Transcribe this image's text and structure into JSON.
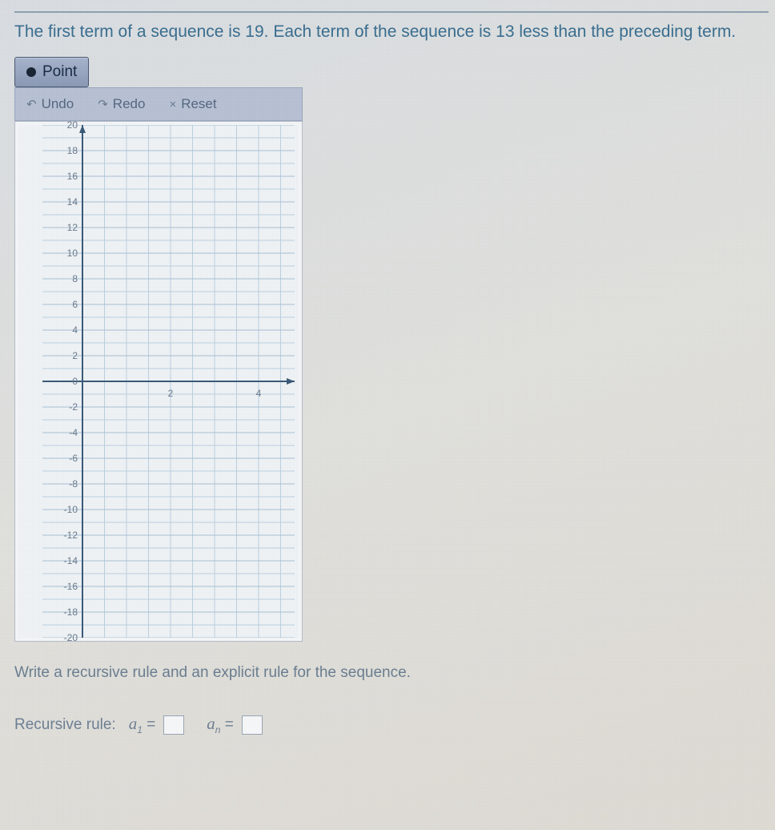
{
  "problem": "The first term of a sequence is 19. Each term of the sequence is 13 less than the preceding term.",
  "toolbar": {
    "point_label": "Point",
    "undo_label": "Undo",
    "redo_label": "Redo",
    "reset_label": "Reset"
  },
  "chart_data": {
    "type": "scatter",
    "title": "",
    "xlabel": "",
    "ylabel": "",
    "xlim": [
      0,
      5
    ],
    "ylim": [
      -20,
      20
    ],
    "xticks": [
      2,
      4
    ],
    "yticks": [
      20,
      18,
      16,
      14,
      12,
      10,
      8,
      6,
      4,
      2,
      0,
      -2,
      -4,
      -6,
      -8,
      -10,
      -12,
      -14,
      -16,
      -18,
      -20
    ],
    "series": [
      {
        "name": "points",
        "values": []
      }
    ]
  },
  "instruction": "Write a recursive rule and an explicit rule for the sequence.",
  "formula": {
    "prefix": "Recursive rule:",
    "a1_lhs": "a",
    "a1_sub": "1",
    "eq": "=",
    "an_lhs": "a",
    "an_sub": "n",
    "a1_value": "",
    "an_value": ""
  }
}
